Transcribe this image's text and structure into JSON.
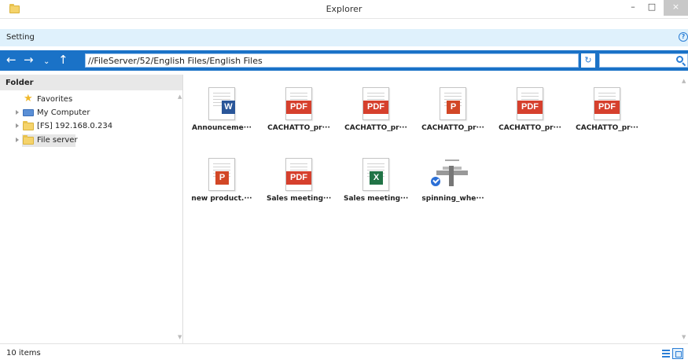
{
  "window": {
    "title": "Explorer",
    "minimize": "–",
    "maximize": "□",
    "close": "×"
  },
  "settings": {
    "label": "Setting",
    "help": "?"
  },
  "address": {
    "path": "//FileServer/52/English Files/English Files",
    "search_placeholder": ""
  },
  "sidebar": {
    "header": "Folder",
    "items": [
      {
        "label": "Favorites",
        "icon": "star-icon"
      },
      {
        "label": "My Computer",
        "icon": "computer-icon"
      },
      {
        "label": "[FS] 192.168.0.234",
        "icon": "folder-icon"
      },
      {
        "label": "File server",
        "icon": "folder-icon",
        "selected": true
      }
    ]
  },
  "files": [
    {
      "name": "Announceme···",
      "type": "word",
      "badge": "W"
    },
    {
      "name": "CACHATTO_pr···",
      "type": "pdf",
      "badge": "PDF"
    },
    {
      "name": "CACHATTO_pr···",
      "type": "pdf",
      "badge": "PDF"
    },
    {
      "name": "CACHATTO_pr···",
      "type": "ppt",
      "badge": "P"
    },
    {
      "name": "CACHATTO_pr···",
      "type": "pdf",
      "badge": "PDF"
    },
    {
      "name": "CACHATTO_pr···",
      "type": "pdf",
      "badge": "PDF"
    },
    {
      "name": "new product.···",
      "type": "ppt",
      "badge": "P"
    },
    {
      "name": "Sales meeting···",
      "type": "pdf",
      "badge": "PDF"
    },
    {
      "name": "Sales meeting···",
      "type": "xls",
      "badge": "X"
    },
    {
      "name": "spinning_whe···",
      "type": "image",
      "badge": ""
    }
  ],
  "status": {
    "item_count": "10 items"
  },
  "colors": {
    "accent": "#1a72c7",
    "settings_bg": "#dff1fc",
    "pdf": "#d6402d",
    "word": "#2a5699",
    "ppt": "#d24726",
    "xls": "#217346"
  }
}
